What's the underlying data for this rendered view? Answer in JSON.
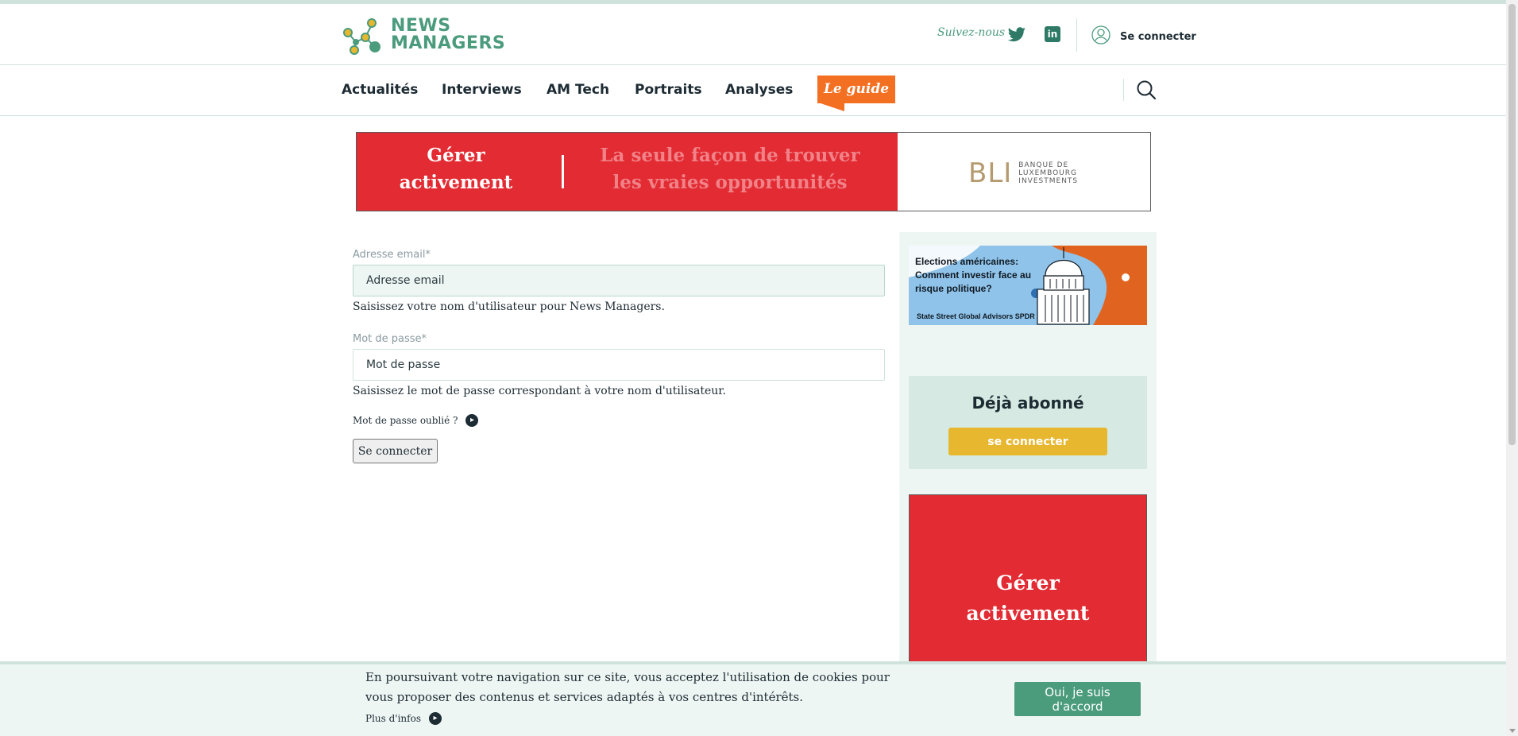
{
  "header": {
    "logo_line1": "NEWS",
    "logo_line2": "MANAGERS",
    "follow_label": "Suivez-nous",
    "twitter_icon": "twitter-icon",
    "linkedin_icon": "linkedin-icon",
    "linkedin_glyph": "in",
    "user_icon": "user-icon",
    "login_label": "Se connecter"
  },
  "nav": {
    "items": [
      "Actualités",
      "Interviews",
      "AM Tech",
      "Portraits",
      "Analyses"
    ],
    "guide_label": "Le guide",
    "search_icon": "search-icon"
  },
  "banner": {
    "left_line1": "Gérer",
    "left_line2": "activement",
    "right_line1": "La seule façon de trouver",
    "right_line2": "les vraies opportunités",
    "brand_mark": "BLI",
    "brand_line1": "BANQUE DE",
    "brand_line2": "LUXEMBOURG",
    "brand_line3": "INVESTMENTS"
  },
  "form": {
    "email_label": "Adresse email*",
    "email_placeholder": "Adresse email",
    "email_value": "",
    "email_help": "Saisissez votre nom d'utilisateur pour News Managers.",
    "password_label": "Mot de passe*",
    "password_placeholder": "Mot de passe",
    "password_value": "",
    "password_help": "Saisissez le mot de passe correspondant à votre nom d'utilisateur.",
    "forgot_label": "Mot de passe oublié ?",
    "submit_label": "Se connecter"
  },
  "sidebar": {
    "ad_text": "Elections américaines: Comment investir face au risque politique?",
    "ad_brand": "State Street  Global Advisors SPDR",
    "subscribed_title": "Déjà abonné",
    "subscribed_button": "se connecter",
    "ad3_line1": "Gérer",
    "ad3_line2": "activement"
  },
  "cookie": {
    "text": "En poursuivant votre navigation sur ce site, vous acceptez l'utilisation de cookies pour vous proposer des contenus et services adaptés à vos centres d'intérêts.",
    "more_label": "Plus d'infos",
    "accept_label": "Oui, je suis d'accord"
  },
  "colors": {
    "brand_green": "#4b9b7d",
    "guide_orange": "#f36f21",
    "ad_red": "#e32b33",
    "subscribe_yellow": "#e8b730",
    "pale_green": "#eef6f3"
  }
}
